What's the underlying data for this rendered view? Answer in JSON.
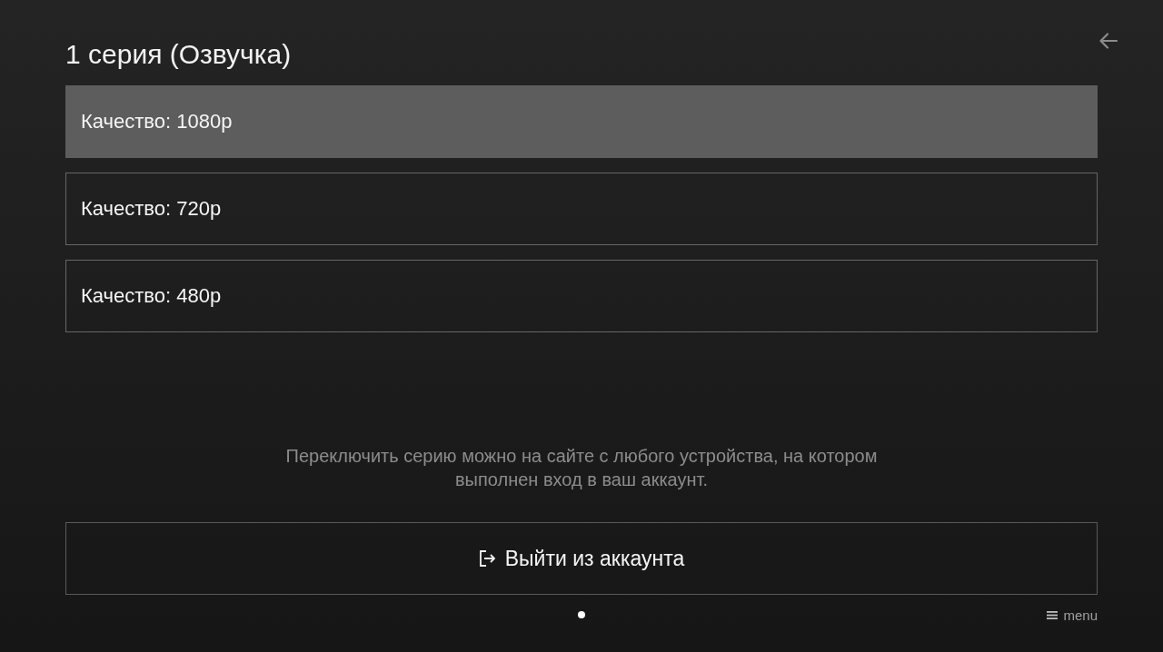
{
  "title": "1 серия (Озвучка)",
  "quality_options": [
    {
      "label": "Качество: 1080p",
      "selected": true
    },
    {
      "label": "Качество: 720p",
      "selected": false
    },
    {
      "label": "Качество: 480p",
      "selected": false
    }
  ],
  "hint": "Переключить серию можно на сайте с любого устройства, на котором выполнен вход в ваш аккаунт.",
  "logout_button": {
    "label": "Выйти из аккаунта"
  },
  "page_dots": [
    {
      "selected": true
    }
  ],
  "menu_button": {
    "label": "menu"
  }
}
